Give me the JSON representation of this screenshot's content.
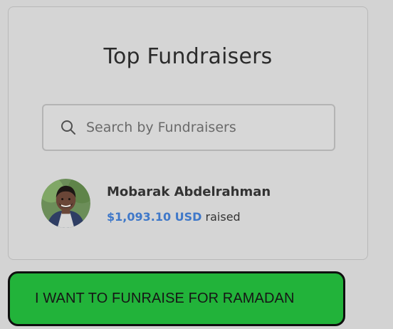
{
  "panel": {
    "title": "Top Fundraisers"
  },
  "search": {
    "placeholder": "Search by Fundraisers",
    "icon": "search-icon"
  },
  "fundraisers": [
    {
      "name": "Mobarak Abdelrahman",
      "amount": "$1,093.10 USD",
      "raised_label": "raised",
      "avatar_icon": "fundraiser-avatar"
    }
  ],
  "cta": {
    "label": "I WANT TO FUNRAISE FOR RAMADAN"
  },
  "colors": {
    "page_background": "#d3d3d3",
    "amount_text": "#3f78c9",
    "cta_background": "#22b33a",
    "cta_border": "#0f0f0f"
  }
}
